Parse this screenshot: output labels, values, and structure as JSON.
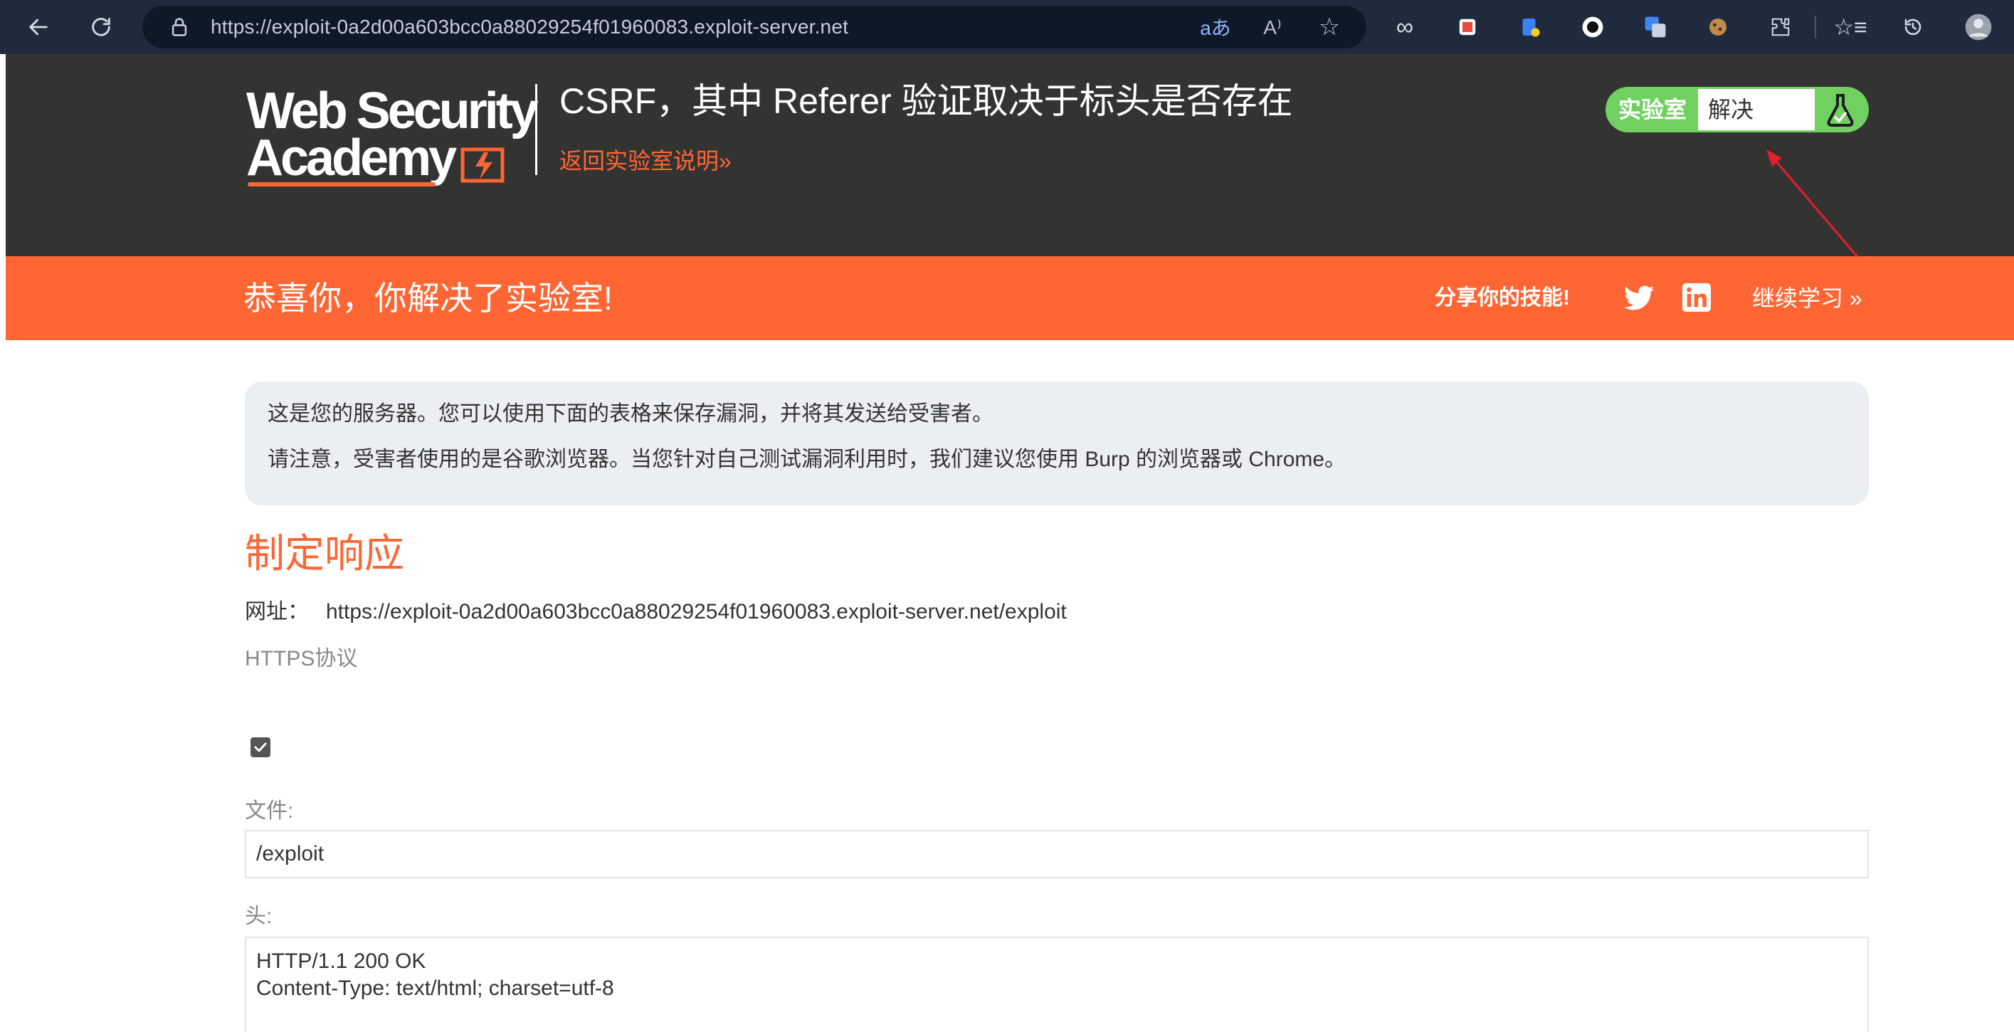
{
  "browser": {
    "url": "https://exploit-0a2d00a603bcc0a88029254f01960083.exploit-server.net"
  },
  "header": {
    "logo_line1": "Web Security",
    "logo_line2": "Academy",
    "lab_title": "CSRF，其中 Referer 验证取决于标头是否存在",
    "back_link": "返回实验室说明»",
    "status_label": "实验室",
    "status_value": "解决"
  },
  "banner": {
    "solved_text": "恭喜你，你解决了实验室!",
    "share_text": "分享你的技能!",
    "continue_link": "继续学习 »"
  },
  "info": {
    "line1": "这是您的服务器。您可以使用下面的表格来保存漏洞，并将其发送给受害者。",
    "line2": "请注意，受害者使用的是谷歌浏览器。当您针对自己测试漏洞利用时，我们建议您使用 Burp 的浏览器或 Chrome。"
  },
  "form": {
    "section_title": "制定响应",
    "url_label": "网址：",
    "url_value": "https://exploit-0a2d00a603bcc0a88029254f01960083.exploit-server.net/exploit",
    "https_label": "HTTPS协议",
    "https_checked": true,
    "file_label": "文件:",
    "file_value": "/exploit",
    "head_label": "头:",
    "head_value": "HTTP/1.1 200 OK\nContent-Type: text/html; charset=utf-8"
  },
  "colors": {
    "orange": "#ff6633",
    "header_dark": "#333332",
    "solved_green": "#70d160",
    "browser_bar": "#1f2b3d"
  },
  "icons": [
    "back-icon",
    "refresh-icon",
    "lock-icon",
    "translate-icon",
    "read-aloud-icon",
    "favorite-icon",
    "infinity-icon",
    "extension-icon",
    "twitter-icon",
    "linkedin-icon",
    "flask-icon"
  ]
}
